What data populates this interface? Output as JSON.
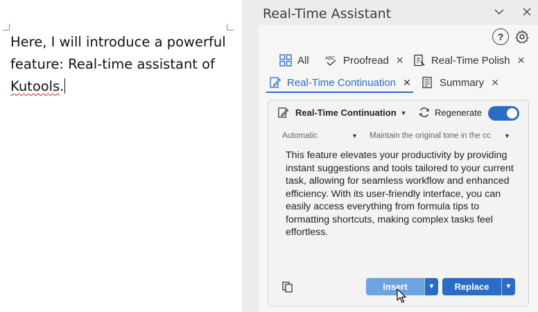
{
  "document": {
    "text_before": "Here, I will introduce a powerful feature: Real-time assistant of ",
    "misspelled_word": "Kutools",
    "text_after": "."
  },
  "pane": {
    "title": "Real-Time Assistant"
  },
  "tabs": [
    {
      "label": "All",
      "icon": "grid-icon",
      "closable": false
    },
    {
      "label": "Proofread",
      "icon": "abc-check-icon",
      "closable": true
    },
    {
      "label": "Real-Time Polish",
      "icon": "polish-doc-icon",
      "closable": true
    },
    {
      "label": "Real-Time Continuation",
      "icon": "edit-doc-icon",
      "closable": true,
      "active": true
    },
    {
      "label": "Summary",
      "icon": "summary-doc-icon",
      "closable": true
    }
  ],
  "card": {
    "mode_label": "Real-Time Continuation",
    "regenerate_label": "Regenerate",
    "toggle_on": true,
    "length_select": "Automatic",
    "tone_select": "Maintain the original tone in the cc",
    "generated_text": "This feature elevates your productivity by providing instant suggestions and tools tailored to your current task, allowing for seamless workflow and enhanced efficiency. With its user-friendly interface, you can easily access everything from formula tips to formatting shortcuts, making complex tasks feel effortless.",
    "insert_label": "Insert",
    "replace_label": "Replace"
  },
  "colors": {
    "accent": "#2b6cc4",
    "insert_hover": "#6ea3df",
    "pane_bg": "#ececec"
  }
}
